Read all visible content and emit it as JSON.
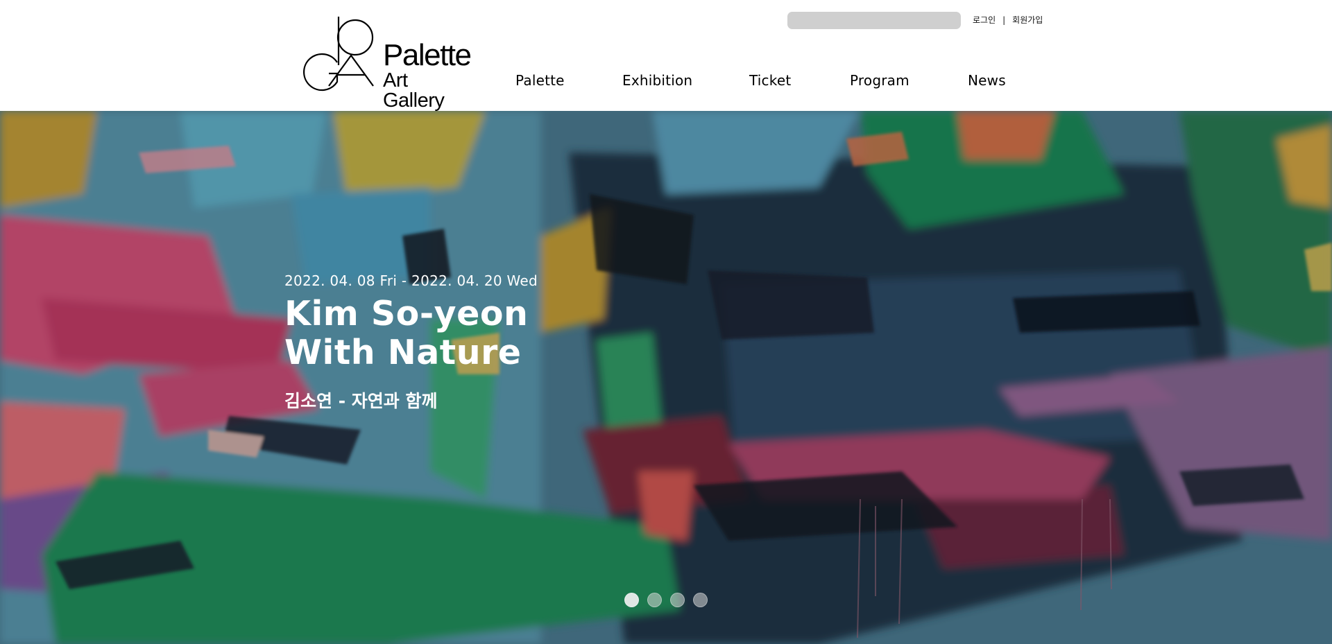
{
  "brand": {
    "line1": "Palette",
    "line2": "Art Gallery",
    "monogram": "PAG monogram logo"
  },
  "search": {
    "value": "",
    "placeholder": ""
  },
  "util_links": {
    "login": "로그인",
    "separator": "|",
    "signup": "회원가입"
  },
  "nav": [
    {
      "label": "Palette"
    },
    {
      "label": "Exhibition"
    },
    {
      "label": "Ticket"
    },
    {
      "label": "Program"
    },
    {
      "label": "News"
    }
  ],
  "hero": {
    "date": "2022. 04. 08 Fri - 2022. 04. 20 Wed",
    "title_line1": "Kim So-yeon",
    "title_line2": "With Nature",
    "subtitle": "김소연 - 자연과 함께",
    "slides_total": 4,
    "active_slide": 1
  },
  "colors": {
    "header_bg": "#ffffff",
    "search_bg": "#cfcfcf",
    "hero_text": "#ffffff",
    "dot_active": "#f0f0f0",
    "dot_inactive": "#d7d7d7"
  }
}
